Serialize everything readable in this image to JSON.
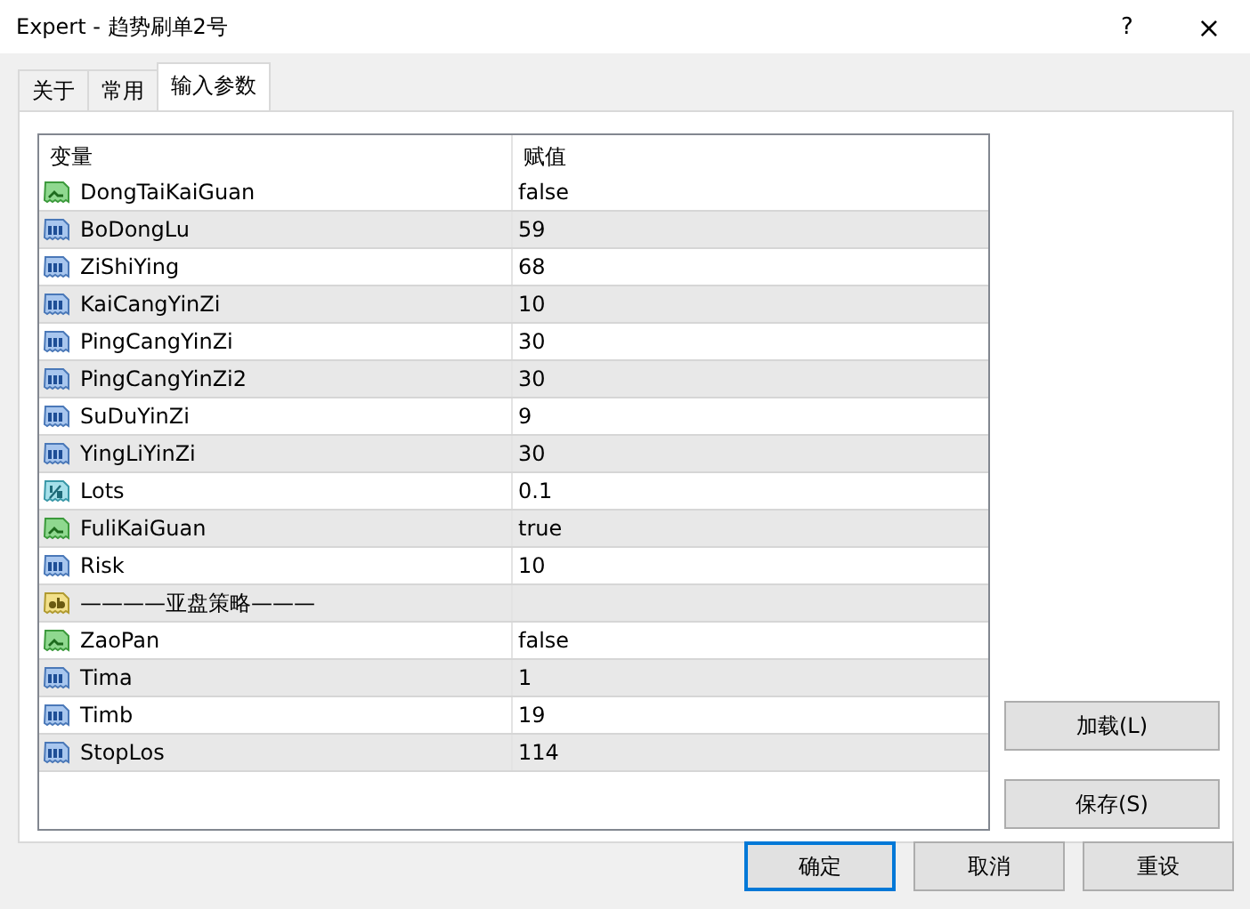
{
  "window": {
    "title": "Expert - 趋势刷单2号",
    "help": "?",
    "close": "×"
  },
  "tabs": [
    {
      "label": "关于",
      "selected": false
    },
    {
      "label": "常用",
      "selected": false
    },
    {
      "label": "输入参数",
      "selected": true
    }
  ],
  "table": {
    "columns": [
      "变量",
      "赋值"
    ],
    "rows": [
      {
        "kind": "bool",
        "name": "DongTaiKaiGuan",
        "value": "false"
      },
      {
        "kind": "int",
        "name": "BoDongLu",
        "value": "59"
      },
      {
        "kind": "int",
        "name": "ZiShiYing",
        "value": "68"
      },
      {
        "kind": "int",
        "name": "KaiCangYinZi",
        "value": "10"
      },
      {
        "kind": "int",
        "name": "PingCangYinZi",
        "value": "30"
      },
      {
        "kind": "int",
        "name": "PingCangYinZi2",
        "value": "30"
      },
      {
        "kind": "int",
        "name": "SuDuYinZi",
        "value": "9"
      },
      {
        "kind": "int",
        "name": "YingLiYinZi",
        "value": "30"
      },
      {
        "kind": "double",
        "name": "Lots",
        "value": "0.1"
      },
      {
        "kind": "bool",
        "name": "FuliKaiGuan",
        "value": "true"
      },
      {
        "kind": "int",
        "name": "Risk",
        "value": "10"
      },
      {
        "kind": "string",
        "name": "————亚盘策略———"
      },
      {
        "kind": "bool",
        "name": "ZaoPan",
        "value": "false"
      },
      {
        "kind": "int",
        "name": "Tima",
        "value": "1"
      },
      {
        "kind": "int",
        "name": "Timb",
        "value": "19"
      },
      {
        "kind": "int",
        "name": "StopLos",
        "value": "114"
      }
    ]
  },
  "side_buttons": [
    "加载(L)",
    "保存(S)"
  ],
  "buttons": [
    {
      "label": "确定",
      "default": true
    },
    {
      "label": "取消",
      "default": false
    },
    {
      "label": "重设",
      "default": false
    }
  ]
}
